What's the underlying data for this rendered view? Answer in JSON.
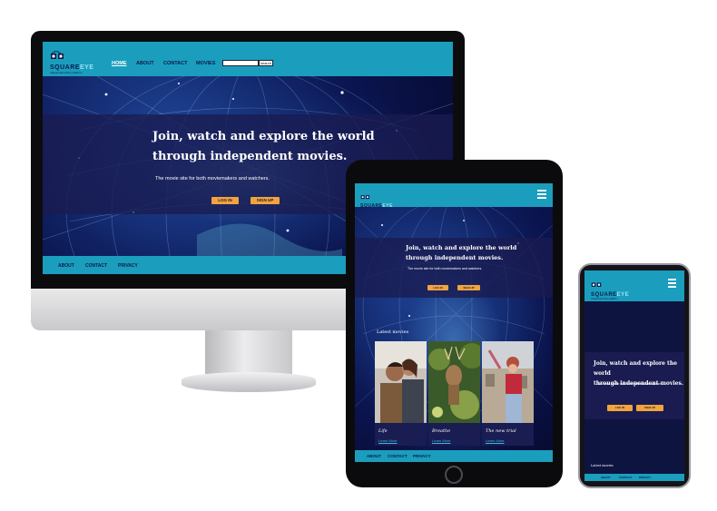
{
  "brand": {
    "name": "SQUARE",
    "name_suffix": "EYE",
    "tagline": "Independent films platform"
  },
  "desktop_nav": {
    "home": "HOME",
    "about": "ABOUT",
    "contact": "CONTACT",
    "movies": "MOVIES",
    "search_button": "search"
  },
  "hero": {
    "title_line1": "Join, watch and explore the world",
    "title_line2": "through independent movies.",
    "subtitle": "The movie site for both moviemakers and watchers.",
    "login": "LOG IN",
    "signup": "SIGN UP"
  },
  "footer": {
    "about": "ABOUT",
    "contact": "CONTACT",
    "privacy": "PRIVACY"
  },
  "latest": {
    "heading": "Latest movies",
    "movies": [
      {
        "title": "Life",
        "link": "Learn More"
      },
      {
        "title": "Breathe",
        "link": "Learn More"
      },
      {
        "title": "The new trial",
        "link": "Learn More"
      }
    ]
  },
  "colors": {
    "teal": "#1b9dbd",
    "navy": "#0e1440",
    "orange": "#f2a33c"
  },
  "icons": [
    "menu-icon",
    "logo-icon",
    "search-icon"
  ]
}
